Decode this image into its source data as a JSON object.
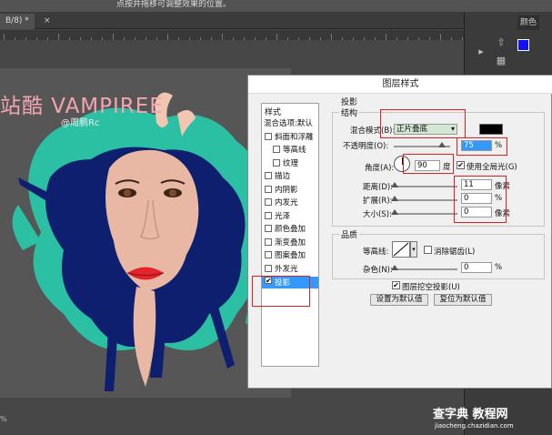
{
  "toolbar": {
    "hint": "点按并拖移可调整效果的位置。"
  },
  "document": {
    "tab_label": "B/8) *",
    "close_glyph": "×"
  },
  "right_panel": {
    "tab_label": "颜色",
    "icons": [
      "arrow-up-icon",
      "grid-icon",
      "pen-icon",
      "type-icon",
      "gear-icon"
    ]
  },
  "artwork": {
    "title": "站酷 VAMPIREE",
    "author": "@周鹏Rc"
  },
  "dialog": {
    "title": "图层样式",
    "styles_header": "样式",
    "style_items": [
      {
        "label": "混合选项:默认",
        "has_checkbox": false,
        "checked": false
      },
      {
        "label": "斜面和浮雕",
        "has_checkbox": true,
        "checked": false
      },
      {
        "label": "等高线",
        "has_checkbox": true,
        "checked": false,
        "indent": true
      },
      {
        "label": "纹理",
        "has_checkbox": true,
        "checked": false,
        "indent": true
      },
      {
        "label": "描边",
        "has_checkbox": true,
        "checked": false
      },
      {
        "label": "内阴影",
        "has_checkbox": true,
        "checked": false
      },
      {
        "label": "内发光",
        "has_checkbox": true,
        "checked": false
      },
      {
        "label": "光泽",
        "has_checkbox": true,
        "checked": false
      },
      {
        "label": "颜色叠加",
        "has_checkbox": true,
        "checked": false
      },
      {
        "label": "渐变叠加",
        "has_checkbox": true,
        "checked": false
      },
      {
        "label": "图案叠加",
        "has_checkbox": true,
        "checked": false
      },
      {
        "label": "外发光",
        "has_checkbox": true,
        "checked": false
      },
      {
        "label": "投影",
        "has_checkbox": true,
        "checked": true,
        "active": true
      }
    ],
    "section_title": "投影",
    "structure": {
      "title": "结构",
      "blend_mode_label": "混合模式(B):",
      "blend_mode_value": "正片叠底",
      "blend_color": "#000000",
      "opacity_label": "不透明度(O):",
      "opacity_value": "75",
      "opacity_unit": "%",
      "angle_label": "角度(A):",
      "angle_value": "90",
      "angle_unit": "度",
      "global_light_label": "使用全局光(G)",
      "global_light_checked": true,
      "distance_label": "距离(D):",
      "distance_value": "11",
      "distance_unit": "像素",
      "spread_label": "扩展(R):",
      "spread_value": "0",
      "spread_unit": "%",
      "size_label": "大小(S):",
      "size_value": "0",
      "size_unit": "像素"
    },
    "quality": {
      "title": "品质",
      "contour_label": "等高线:",
      "antialias_label": "消除锯齿(L)",
      "noise_label": "杂色(N):",
      "noise_value": "0",
      "noise_unit": "%"
    },
    "knockout_label": "图层挖空投影(U)",
    "knockout_checked": true,
    "set_default_button": "设置为默认值",
    "reset_default_button": "复位为默认值"
  },
  "watermark": {
    "main": "查字典 教程网",
    "sub": "jiaocheng.chazidian.com"
  },
  "status": {
    "text": "%"
  },
  "colors": {
    "accent": "#3399ff",
    "highlight_red": "#e02020",
    "art_teal": "#2bbfa3",
    "art_navy": "#0d1f6e"
  }
}
